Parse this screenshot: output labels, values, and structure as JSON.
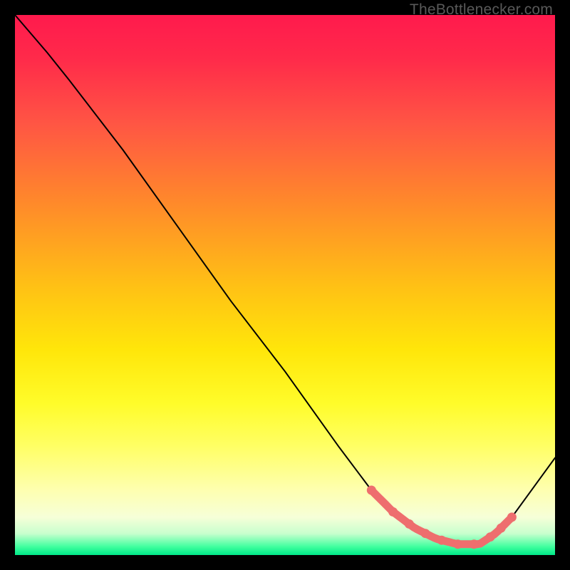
{
  "attribution": "TheBottlenecker.com",
  "chart_data": {
    "type": "line",
    "title": "",
    "xlabel": "",
    "ylabel": "",
    "xlim": [
      0,
      100
    ],
    "ylim": [
      0,
      100
    ],
    "series": [
      {
        "name": "bottleneck-curve",
        "x": [
          0,
          6,
          10,
          20,
          30,
          40,
          50,
          60,
          66,
          70,
          74,
          78,
          82,
          86,
          89,
          92,
          100
        ],
        "y": [
          100,
          93,
          88,
          75,
          61,
          47,
          34,
          20,
          12,
          8,
          5,
          3,
          2,
          2,
          4,
          7,
          18
        ]
      }
    ],
    "highlight_range_x": [
      66,
      92
    ],
    "highlight_markers_x": [
      66,
      70,
      73,
      76,
      79,
      82,
      85,
      88,
      90,
      92
    ],
    "colors": {
      "line": "#000000",
      "highlight": "#ee6e6e",
      "gradient_top": "#ff1a4d",
      "gradient_bottom": "#00e888"
    }
  }
}
